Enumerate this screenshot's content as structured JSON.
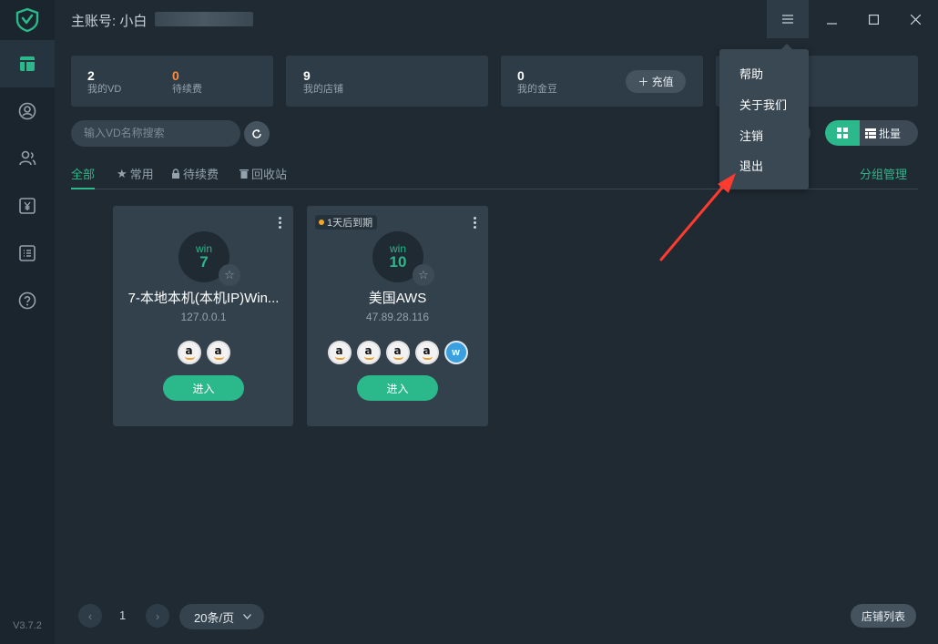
{
  "titlebar": {
    "account_label": "主账号: 小白",
    "menu_icon": "hamburger-icon",
    "minimize_icon": "minimize-icon",
    "maximize_icon": "maximize-icon",
    "close_icon": "close-icon"
  },
  "sidebar": {
    "version": "V3.7.2",
    "items": [
      {
        "icon": "dashboard-icon",
        "active": true
      },
      {
        "icon": "user-circle-icon",
        "active": false
      },
      {
        "icon": "users-icon",
        "active": false
      },
      {
        "icon": "yen-icon",
        "active": false
      },
      {
        "icon": "list-icon",
        "active": false
      },
      {
        "icon": "help-icon",
        "active": false
      }
    ]
  },
  "stats": {
    "vd": {
      "value": "2",
      "label": "我的VD"
    },
    "pending": {
      "value": "0",
      "label": "待续费"
    },
    "stores": {
      "value": "9",
      "label": "我的店铺"
    },
    "coins": {
      "value": "0",
      "label": "我的金豆"
    },
    "recharge_label": "＋ 充值"
  },
  "search": {
    "placeholder": "输入VD名称搜索"
  },
  "view": {
    "batch_label": "批量"
  },
  "tabs": [
    {
      "label": "全部",
      "active": true
    },
    {
      "label": "常用",
      "icon": "star-icon"
    },
    {
      "label": "待续费",
      "icon": "lock-icon"
    },
    {
      "label": "回收站",
      "icon": "trash-icon"
    }
  ],
  "group_mgmt": "分组管理",
  "vds": [
    {
      "badge": "",
      "os_name": "win",
      "os_version": "7",
      "name": "7-本地本机(本机IP)Win...",
      "ip": "127.0.0.1",
      "shops": [
        "amazon",
        "amazon"
      ],
      "enter_label": "进入"
    },
    {
      "badge": "1天后到期",
      "os_name": "win",
      "os_version": "10",
      "name": "美国AWS",
      "ip": "47.89.28.116",
      "shops": [
        "amazon",
        "amazon",
        "amazon",
        "amazon",
        "wish"
      ],
      "enter_label": "进入"
    }
  ],
  "dropdown": {
    "items": [
      "帮助",
      "关于我们",
      "注销",
      "退出"
    ]
  },
  "pagination": {
    "current": "1",
    "per_page": "20条/页"
  },
  "shop_list_label": "店铺列表",
  "colors": {
    "accent": "#2bb88a",
    "warning": "#ff8a3d",
    "arrow": "#ff3b30"
  }
}
